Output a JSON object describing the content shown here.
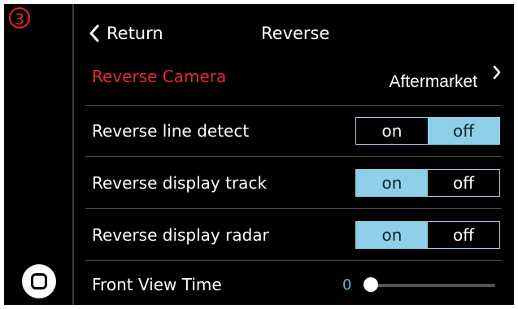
{
  "step_marker": "3",
  "header": {
    "back_label": "Return",
    "title": "Reverse"
  },
  "rows": {
    "camera": {
      "label": "Reverse Camera",
      "value": "Aftermarket"
    },
    "line_detect": {
      "label": "Reverse line detect",
      "on_label": "on",
      "off_label": "off",
      "selected": "off"
    },
    "display_track": {
      "label": "Reverse display track",
      "on_label": "on",
      "off_label": "off",
      "selected": "on"
    },
    "display_radar": {
      "label": "Reverse display radar",
      "on_label": "on",
      "off_label": "off",
      "selected": "on"
    },
    "front_view_time": {
      "label": "Front View Time",
      "value": "0",
      "level": 0
    }
  },
  "colors": {
    "accent": "#8fd0e8",
    "highlight_text": "#e22b2b",
    "slider_value": "#55b8e0",
    "background": "#000000"
  },
  "icons": {
    "back": "chevron-left-icon",
    "forward": "chevron-right-icon",
    "home": "home-square-icon"
  }
}
